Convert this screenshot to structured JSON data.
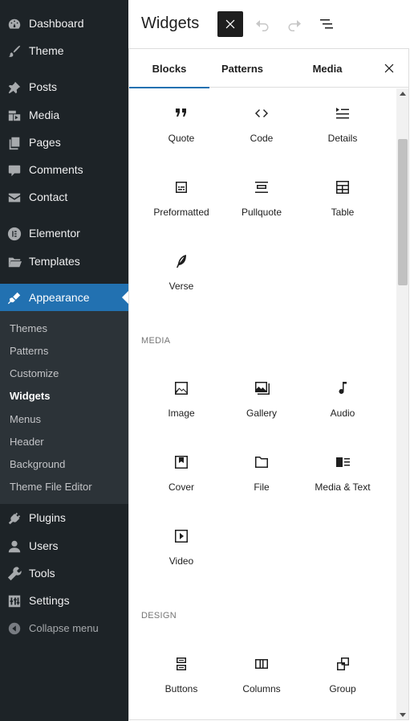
{
  "sidebar": {
    "items": [
      {
        "label": "Dashboard",
        "icon": "dashboard-icon"
      },
      {
        "label": "Theme",
        "icon": "brush-icon"
      },
      {
        "label": "Posts",
        "icon": "pin-icon"
      },
      {
        "label": "Media",
        "icon": "media-icon"
      },
      {
        "label": "Pages",
        "icon": "pages-icon"
      },
      {
        "label": "Comments",
        "icon": "comment-icon"
      },
      {
        "label": "Contact",
        "icon": "envelope-icon"
      },
      {
        "label": "Elementor",
        "icon": "elementor-icon"
      },
      {
        "label": "Templates",
        "icon": "folder-icon"
      },
      {
        "label": "Appearance",
        "icon": "paintbrush-icon"
      },
      {
        "label": "Plugins",
        "icon": "plug-icon"
      },
      {
        "label": "Users",
        "icon": "user-icon"
      },
      {
        "label": "Tools",
        "icon": "wrench-icon"
      },
      {
        "label": "Settings",
        "icon": "sliders-icon"
      },
      {
        "label": "Collapse menu",
        "icon": "collapse-icon"
      }
    ],
    "submenu": [
      "Themes",
      "Patterns",
      "Customize",
      "Widgets",
      "Menus",
      "Header",
      "Background",
      "Theme File Editor"
    ],
    "active_item": "Appearance",
    "current_subitem": "Widgets"
  },
  "header": {
    "title": "Widgets"
  },
  "inserter": {
    "tabs": [
      "Blocks",
      "Patterns",
      "Media"
    ],
    "active_tab": "Blocks",
    "categories": {
      "media": "MEDIA",
      "design": "DESIGN"
    },
    "blocks": {
      "quote": "Quote",
      "code": "Code",
      "details": "Details",
      "preformatted": "Preformatted",
      "pullquote": "Pullquote",
      "table": "Table",
      "verse": "Verse",
      "image": "Image",
      "gallery": "Gallery",
      "audio": "Audio",
      "cover": "Cover",
      "file": "File",
      "media_text": "Media & Text",
      "video": "Video",
      "buttons": "Buttons",
      "columns": "Columns",
      "group": "Group"
    }
  },
  "colors": {
    "sidebar_bg": "#1d2327",
    "submenu_bg": "#2c3338",
    "accent": "#2271b1"
  }
}
